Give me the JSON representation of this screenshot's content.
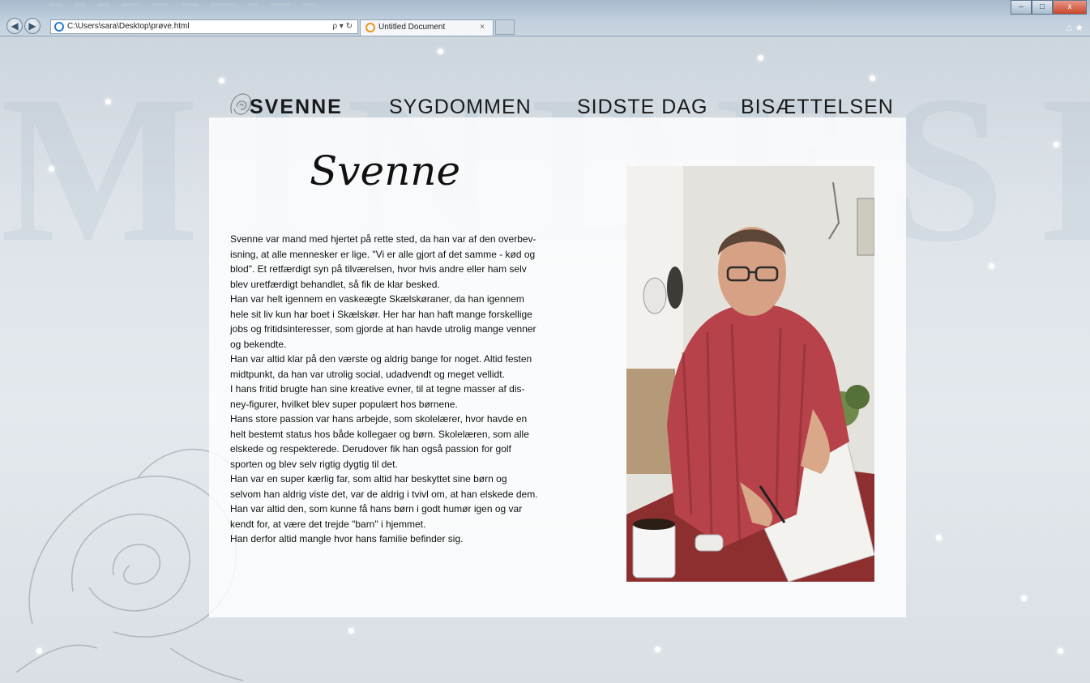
{
  "browser": {
    "address": "C:\\Users\\sara\\Desktop\\prøve.html",
    "address_tools": "ρ ▾ ↻",
    "tab_title": "Untitled Document",
    "tab_close": "×",
    "back": "◀",
    "forward": "▶",
    "min": "–",
    "max": "□",
    "close": "x",
    "home_star": "⌂ ★"
  },
  "nav": {
    "items": [
      "SVENNE",
      "SYGDOMMEN",
      "SIDSTE DAG",
      "BISÆTTELSEN"
    ]
  },
  "page": {
    "heading": "Svenne",
    "bio": [
      "Svenne var mand med hjertet på rette sted, da han var af den overbev-",
      "isning, at alle mennesker er lige. \"Vi er alle gjort af det samme - kød og",
      "blod\". Et retfærdigt syn på tilværelsen, hvor hvis andre eller ham selv",
      "blev uretfærdigt behandlet, så fik de klar besked.",
      "Han var helt igennem en vaskeægte Skælskøraner, da han igennem",
      "hele sit liv kun har boet i Skælskør. Her har han haft mange forskellige",
      "jobs og fritidsinteresser, som gjorde at han havde utrolig mange venner",
      "og bekendte.",
      "Han var altid klar på den værste og aldrig bange for noget. Altid festen",
      "midtpunkt, da han var utrolig social, udadvendt og meget vellidt.",
      "I hans fritid brugte han sine kreative evner, til at tegne masser af dis-",
      "ney-figurer, hvilket blev super populært hos børnene.",
      "Hans store passion var hans arbejde, som skolelærer, hvor havde en",
      "helt bestemt status hos både kollegaer og børn. Skolelæren, som alle",
      "elskede og respekterede. Derudover fik han også passion for golf",
      "sporten og blev selv rigtig dygtig til det.",
      "Han var en super kærlig far, som altid har beskyttet sine børn og",
      "selvom han aldrig viste det, var de aldrig i tvivl om, at han elskede dem.",
      "Han var altid den, som kunne få hans børn i godt humør igen og var",
      "kendt for, at være det trejde \"barn\" i hjemmet.",
      "Han derfor altid mangle hvor hans familie befinder sig."
    ]
  },
  "colors": {
    "accent_red": "#b8424a",
    "text": "#111111"
  }
}
